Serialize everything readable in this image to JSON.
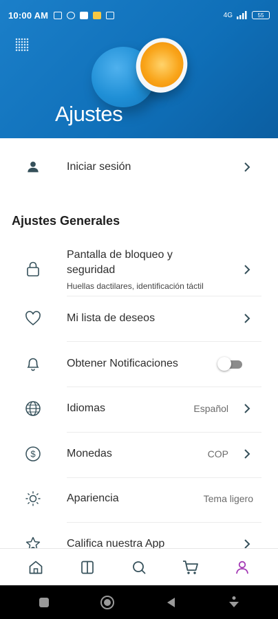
{
  "status_bar": {
    "time": "10:00 AM",
    "network": "4G",
    "battery": "55"
  },
  "header": {
    "title": "Ajustes"
  },
  "login": {
    "label": "Iniciar sesión"
  },
  "general": {
    "section_title": "Ajustes Generales",
    "items": [
      {
        "label": "Pantalla de bloqueo y seguridad",
        "label_line1": "Pantalla de bloqueo y",
        "label_line2": "seguridad",
        "subtitle": "Huellas dactilares, identificación táctil",
        "icon": "lock-icon"
      },
      {
        "label": "Mi lista de deseos",
        "icon": "heart-icon"
      },
      {
        "label": "Obtener Notificaciones",
        "icon": "bell-icon",
        "toggle": false
      },
      {
        "label": "Idiomas",
        "value": "Español",
        "icon": "globe-icon"
      },
      {
        "label": "Monedas",
        "value": "COP",
        "icon": "currency-icon"
      },
      {
        "label": "Apariencia",
        "value": "Tema ligero",
        "icon": "sun-icon"
      },
      {
        "label": "Califica nuestra App",
        "icon": "star-icon"
      }
    ]
  },
  "bottom_nav": {
    "items": [
      {
        "icon": "home-icon"
      },
      {
        "icon": "catalog-icon"
      },
      {
        "icon": "search-icon"
      },
      {
        "icon": "cart-icon"
      },
      {
        "icon": "profile-icon",
        "active": true
      }
    ],
    "active_color": "#a43ab5"
  },
  "colors": {
    "header_blue": "#1277c2",
    "icon_dark": "#35505a"
  }
}
